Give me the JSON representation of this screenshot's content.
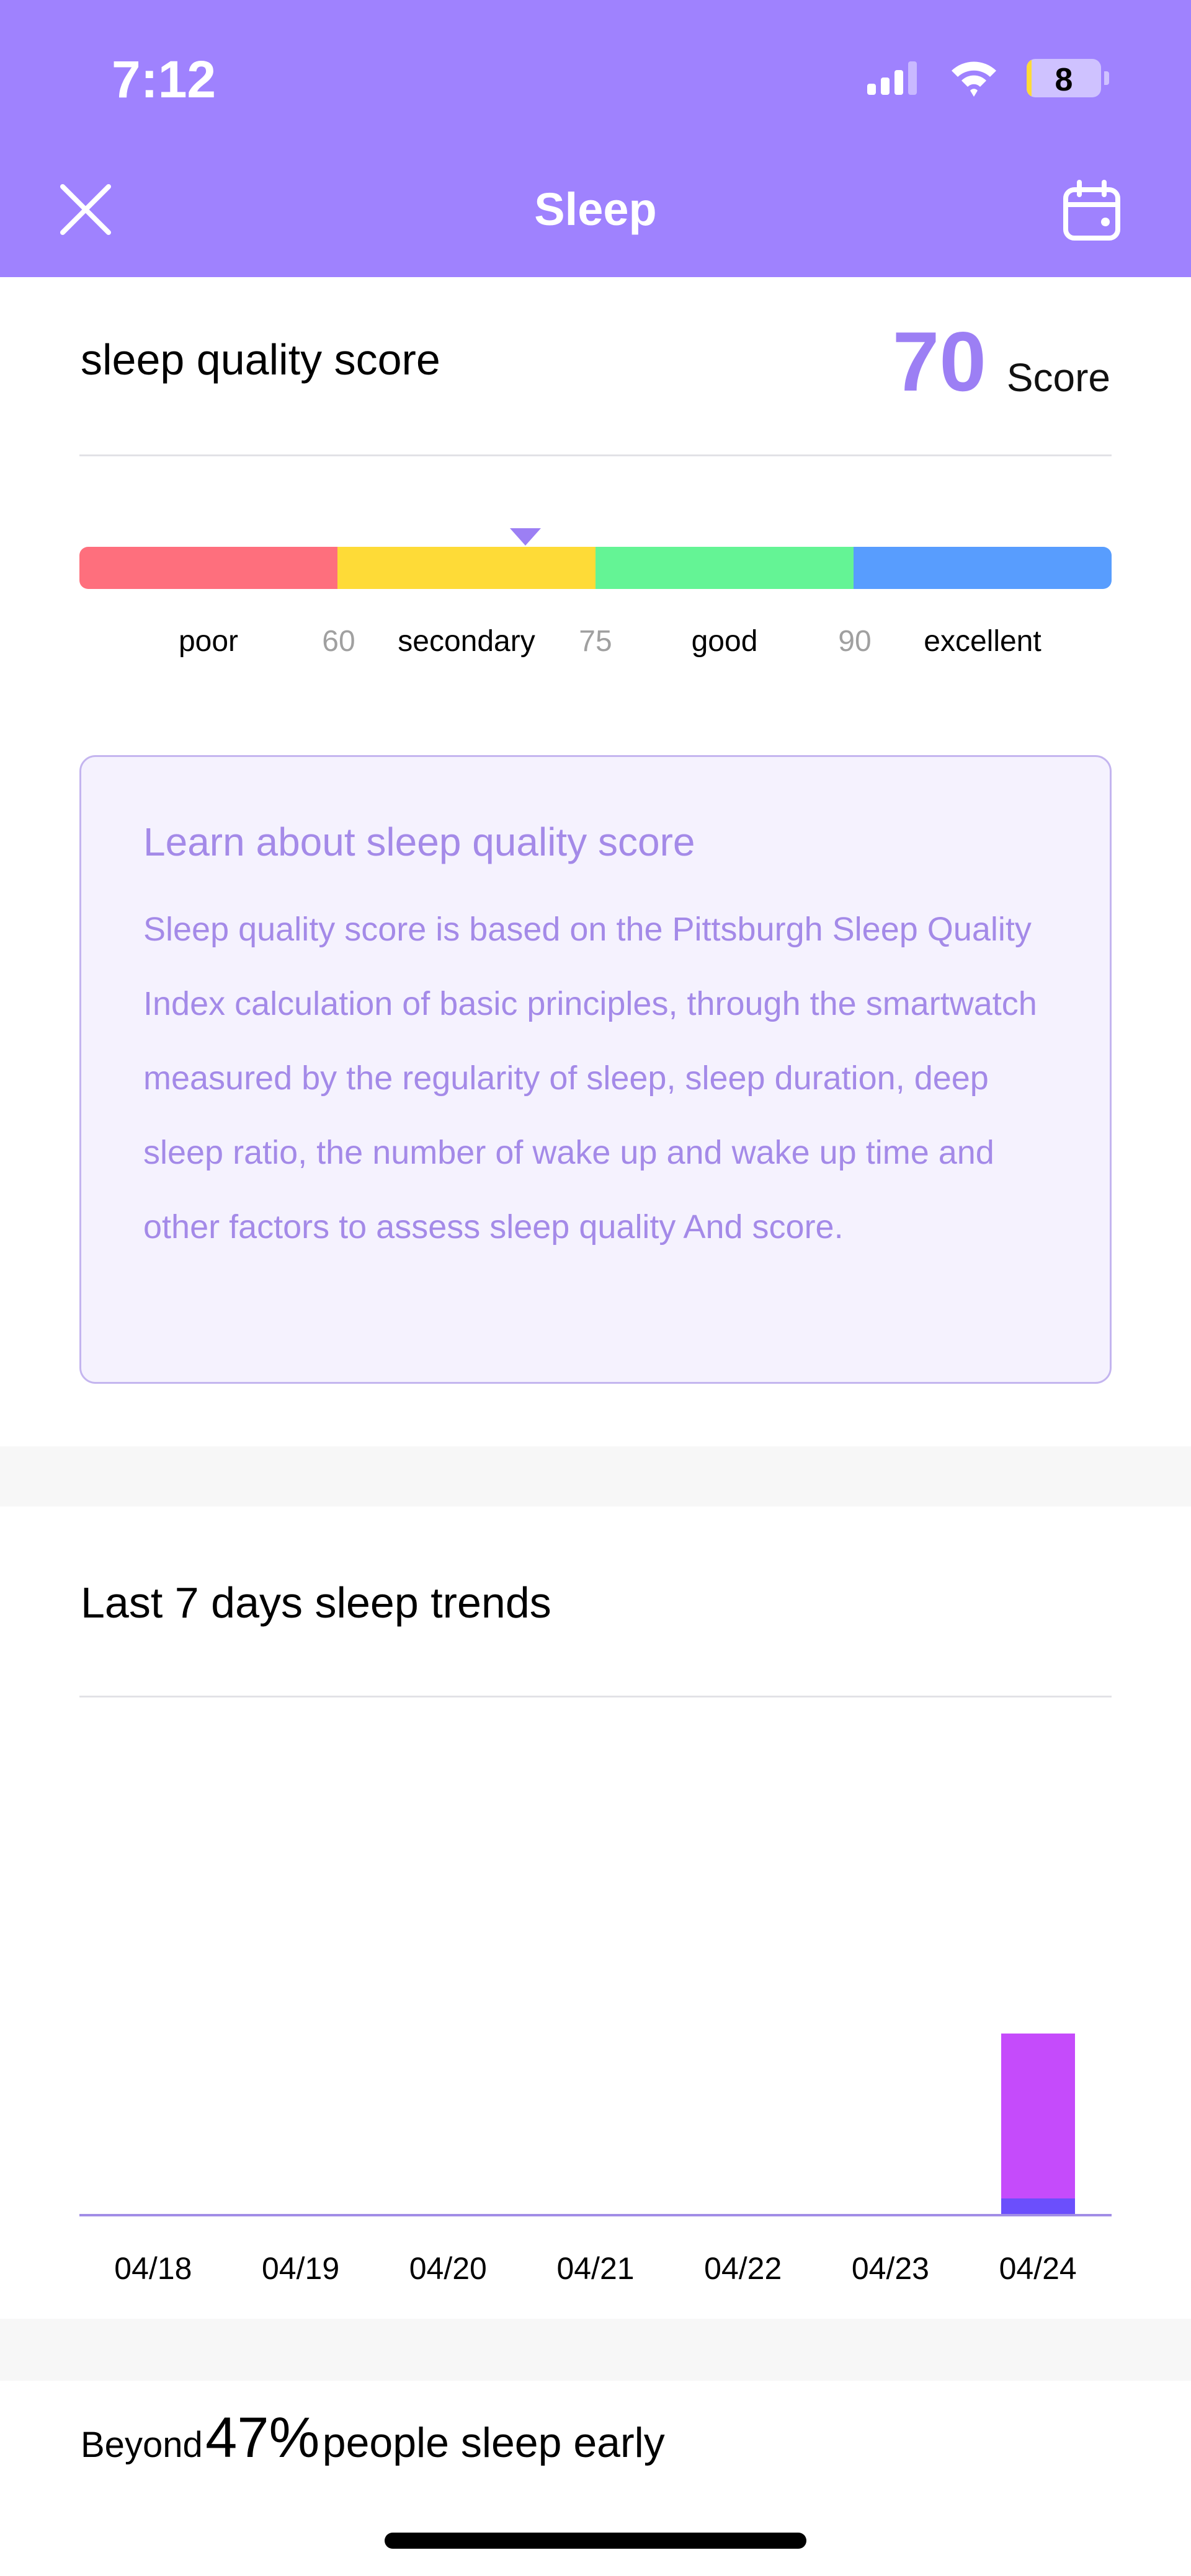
{
  "status_bar": {
    "time": "7:12",
    "battery": "8",
    "icons": [
      "signal-icon",
      "wifi-icon",
      "battery-icon"
    ]
  },
  "header": {
    "title": "Sleep",
    "left_icon": "close-icon",
    "right_icon": "calendar-icon",
    "color": "#9f82fe"
  },
  "score_section": {
    "title": "sleep quality score",
    "score": "70",
    "unit": "Score",
    "scale": {
      "marker_value": 70,
      "segments": [
        {
          "label": "poor",
          "color": "#fe6f7d"
        },
        {
          "label": "secondary",
          "color": "#fedb37"
        },
        {
          "label": "good",
          "color": "#64f495"
        },
        {
          "label": "excellent",
          "color": "#589dfe"
        }
      ],
      "thresholds": [
        "60",
        "75",
        "90"
      ]
    }
  },
  "info": {
    "title": "Learn about sleep quality score",
    "body": "Sleep quality score is based on the Pittsburgh Sleep Quality Index calculation of basic principles, through the smartwatch measured by the regularity of sleep, sleep duration, deep sleep ratio, the number of wake up and wake up time and other factors to assess sleep quality And score."
  },
  "trends": {
    "title": "Last 7 days sleep trends"
  },
  "chart_data": {
    "type": "bar",
    "stacked": true,
    "categories": [
      "04/18",
      "04/19",
      "04/20",
      "04/21",
      "04/22",
      "04/23",
      "04/24"
    ],
    "series": [
      {
        "values": [
          0,
          0,
          0,
          0,
          0,
          0,
          3.3
        ],
        "color": "#6b4ffc"
      },
      {
        "values": [
          0,
          0,
          0,
          0,
          0,
          0,
          31.9
        ],
        "color": "#c54bfb"
      }
    ],
    "ylim": [
      0,
      100
    ],
    "grid": false
  },
  "beyond": {
    "prefix": "Beyond",
    "percent": "47%",
    "suffix": "people sleep early"
  }
}
